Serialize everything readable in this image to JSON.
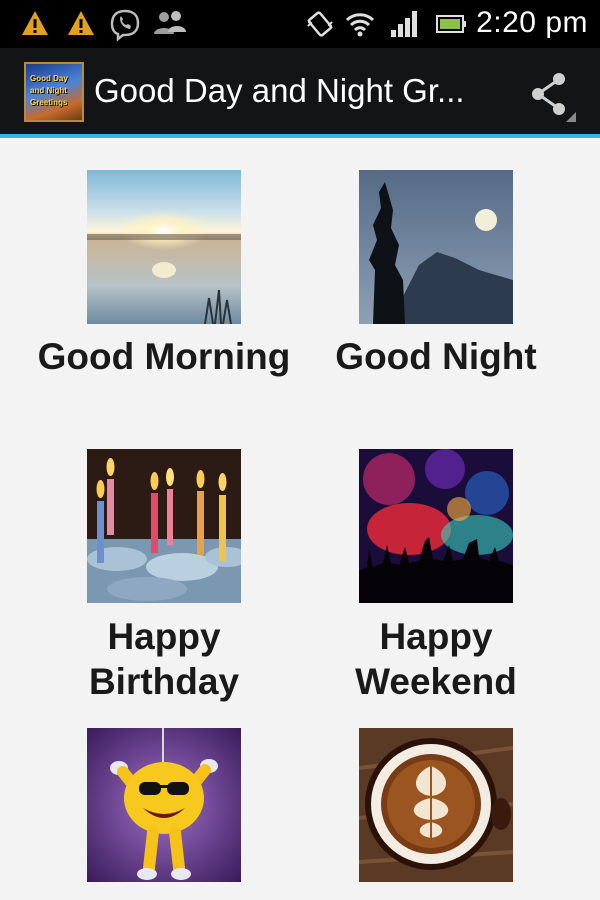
{
  "status_bar": {
    "time": "2:20 pm",
    "icons": [
      "warning-icon",
      "warning-icon",
      "viber-icon",
      "contacts-icon",
      "vibrate-icon",
      "wifi-icon",
      "signal-icon",
      "battery-icon"
    ]
  },
  "action_bar": {
    "app_title": "Good Day and Night Gr...",
    "logo_text": [
      "Good Day",
      "and Night",
      "Greetings"
    ],
    "share_icon": "share-icon"
  },
  "categories": [
    {
      "label_line1": "Good Morning",
      "label_line2": "",
      "image": "sunrise-over-lake"
    },
    {
      "label_line1": "Good Night",
      "label_line2": "",
      "image": "moon-over-mountains"
    },
    {
      "label_line1": "Happy",
      "label_line2": "Birthday",
      "image": "birthday-candles"
    },
    {
      "label_line1": "Happy",
      "label_line2": "Weekend",
      "image": "party-crowd"
    },
    {
      "label_line1": "",
      "label_line2": "",
      "image": "smiley-plush"
    },
    {
      "label_line1": "",
      "label_line2": "",
      "image": "latte-art-coffee"
    }
  ],
  "colors": {
    "accent": "#33b5e5",
    "action_bar": "#121416",
    "background": "#f3f3f3"
  }
}
